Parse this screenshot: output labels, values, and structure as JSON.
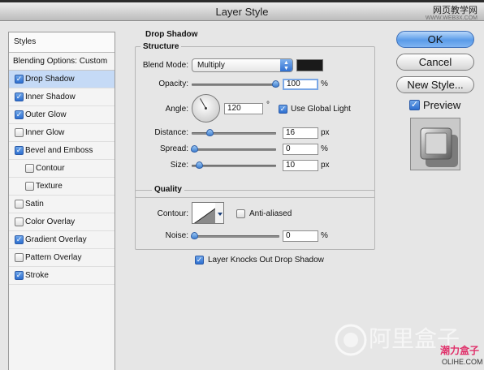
{
  "window": {
    "title": "Layer Style"
  },
  "watermark": {
    "top_cn": "网页教学网",
    "top_url": "WWW.WEB3X.COM",
    "bottom_cn": "潮力盒子",
    "bottom_url": "OLIHE.COM"
  },
  "sidebar": {
    "header": "Styles",
    "blending": "Blending Options: Custom",
    "items": [
      {
        "label": "Drop Shadow",
        "checked": true,
        "active": true,
        "sub": false
      },
      {
        "label": "Inner Shadow",
        "checked": true,
        "active": false,
        "sub": false
      },
      {
        "label": "Outer Glow",
        "checked": true,
        "active": false,
        "sub": false
      },
      {
        "label": "Inner Glow",
        "checked": false,
        "active": false,
        "sub": false
      },
      {
        "label": "Bevel and Emboss",
        "checked": true,
        "active": false,
        "sub": false
      },
      {
        "label": "Contour",
        "checked": false,
        "active": false,
        "sub": true
      },
      {
        "label": "Texture",
        "checked": false,
        "active": false,
        "sub": true
      },
      {
        "label": "Satin",
        "checked": false,
        "active": false,
        "sub": false
      },
      {
        "label": "Color Overlay",
        "checked": false,
        "active": false,
        "sub": false
      },
      {
        "label": "Gradient Overlay",
        "checked": true,
        "active": false,
        "sub": false
      },
      {
        "label": "Pattern Overlay",
        "checked": false,
        "active": false,
        "sub": false
      },
      {
        "label": "Stroke",
        "checked": true,
        "active": false,
        "sub": false
      }
    ]
  },
  "drop_shadow": {
    "title": "Drop Shadow",
    "structure": {
      "title": "Structure",
      "blend_mode_label": "Blend Mode:",
      "blend_mode_value": "Multiply",
      "shadow_color": "#1a1a1a",
      "opacity_label": "Opacity:",
      "opacity_value": "100",
      "opacity_level": 1.0,
      "opacity_unit": "%",
      "angle_label": "Angle:",
      "angle_value": "120",
      "angle_unit": "°",
      "use_global_light_label": "Use Global Light",
      "use_global_light": true,
      "distance_label": "Distance:",
      "distance_value": "16",
      "distance_level": 0.2,
      "distance_unit": "px",
      "spread_label": "Spread:",
      "spread_value": "0",
      "spread_level": 0.0,
      "spread_unit": "%",
      "size_label": "Size:",
      "size_value": "10",
      "size_level": 0.06,
      "size_unit": "px"
    },
    "quality": {
      "title": "Quality",
      "contour_label": "Contour:",
      "anti_aliased_label": "Anti-aliased",
      "anti_aliased": false,
      "noise_label": "Noise:",
      "noise_value": "0",
      "noise_level": 0.0,
      "noise_unit": "%"
    },
    "knockout_label": "Layer Knocks Out Drop Shadow",
    "knockout": true
  },
  "buttons": {
    "ok": "OK",
    "cancel": "Cancel",
    "new_style": "New Style..."
  },
  "preview": {
    "label": "Preview",
    "checked": true
  },
  "colors": {
    "accent": "#3f7fd0",
    "active_row": "#c5daf6"
  }
}
